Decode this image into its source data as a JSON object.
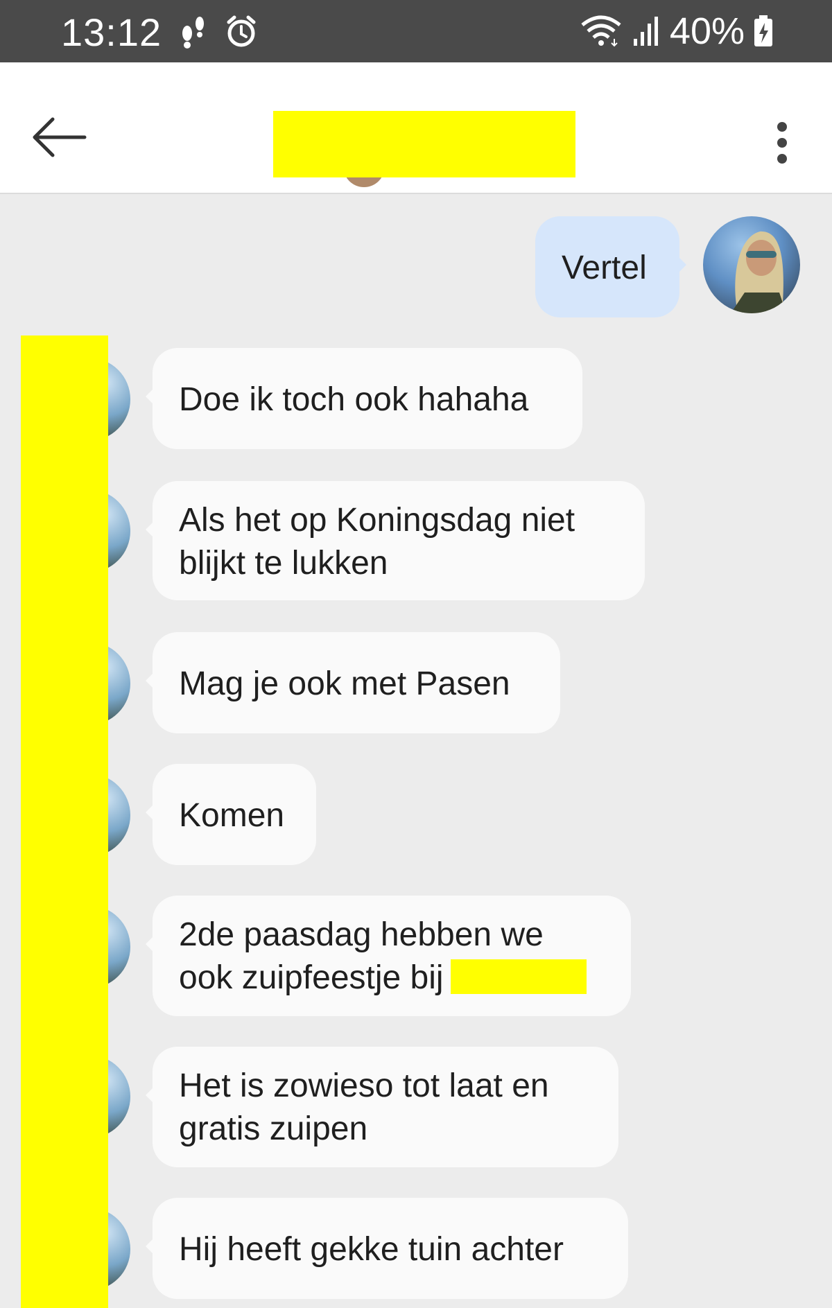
{
  "status_bar": {
    "time": "13:12",
    "battery": "40%",
    "icons": [
      "footsteps-icon",
      "alarm-icon",
      "wifi-icon",
      "signal-icon",
      "battery-charging-icon"
    ]
  },
  "header": {
    "back_icon": "arrow-left-icon",
    "more_icon": "more-vertical-icon"
  },
  "messages": [
    {
      "direction": "out",
      "lines": [
        "Vertel"
      ]
    },
    {
      "direction": "in",
      "lines": [
        "Doe ik toch ook hahaha"
      ]
    },
    {
      "direction": "in",
      "lines": [
        "Als het op Koningsdag niet",
        "blijkt te lukken"
      ]
    },
    {
      "direction": "in",
      "lines": [
        "Mag je ook met Pasen"
      ]
    },
    {
      "direction": "in",
      "lines": [
        "Komen"
      ]
    },
    {
      "direction": "in",
      "lines": [
        "2de paasdag hebben we",
        "ook zuipfeestje bij"
      ]
    },
    {
      "direction": "in",
      "lines": [
        "Het is zowieso tot laat en",
        "gratis zuipen"
      ]
    },
    {
      "direction": "in",
      "lines": [
        "Hij heeft gekke tuin achter"
      ]
    }
  ],
  "colors": {
    "status_bar": "#4a4a4a",
    "background": "#ececec",
    "outgoing_bubble": "#d6e6fb",
    "incoming_bubble": "#fafafa",
    "redaction": "#ffff00"
  }
}
